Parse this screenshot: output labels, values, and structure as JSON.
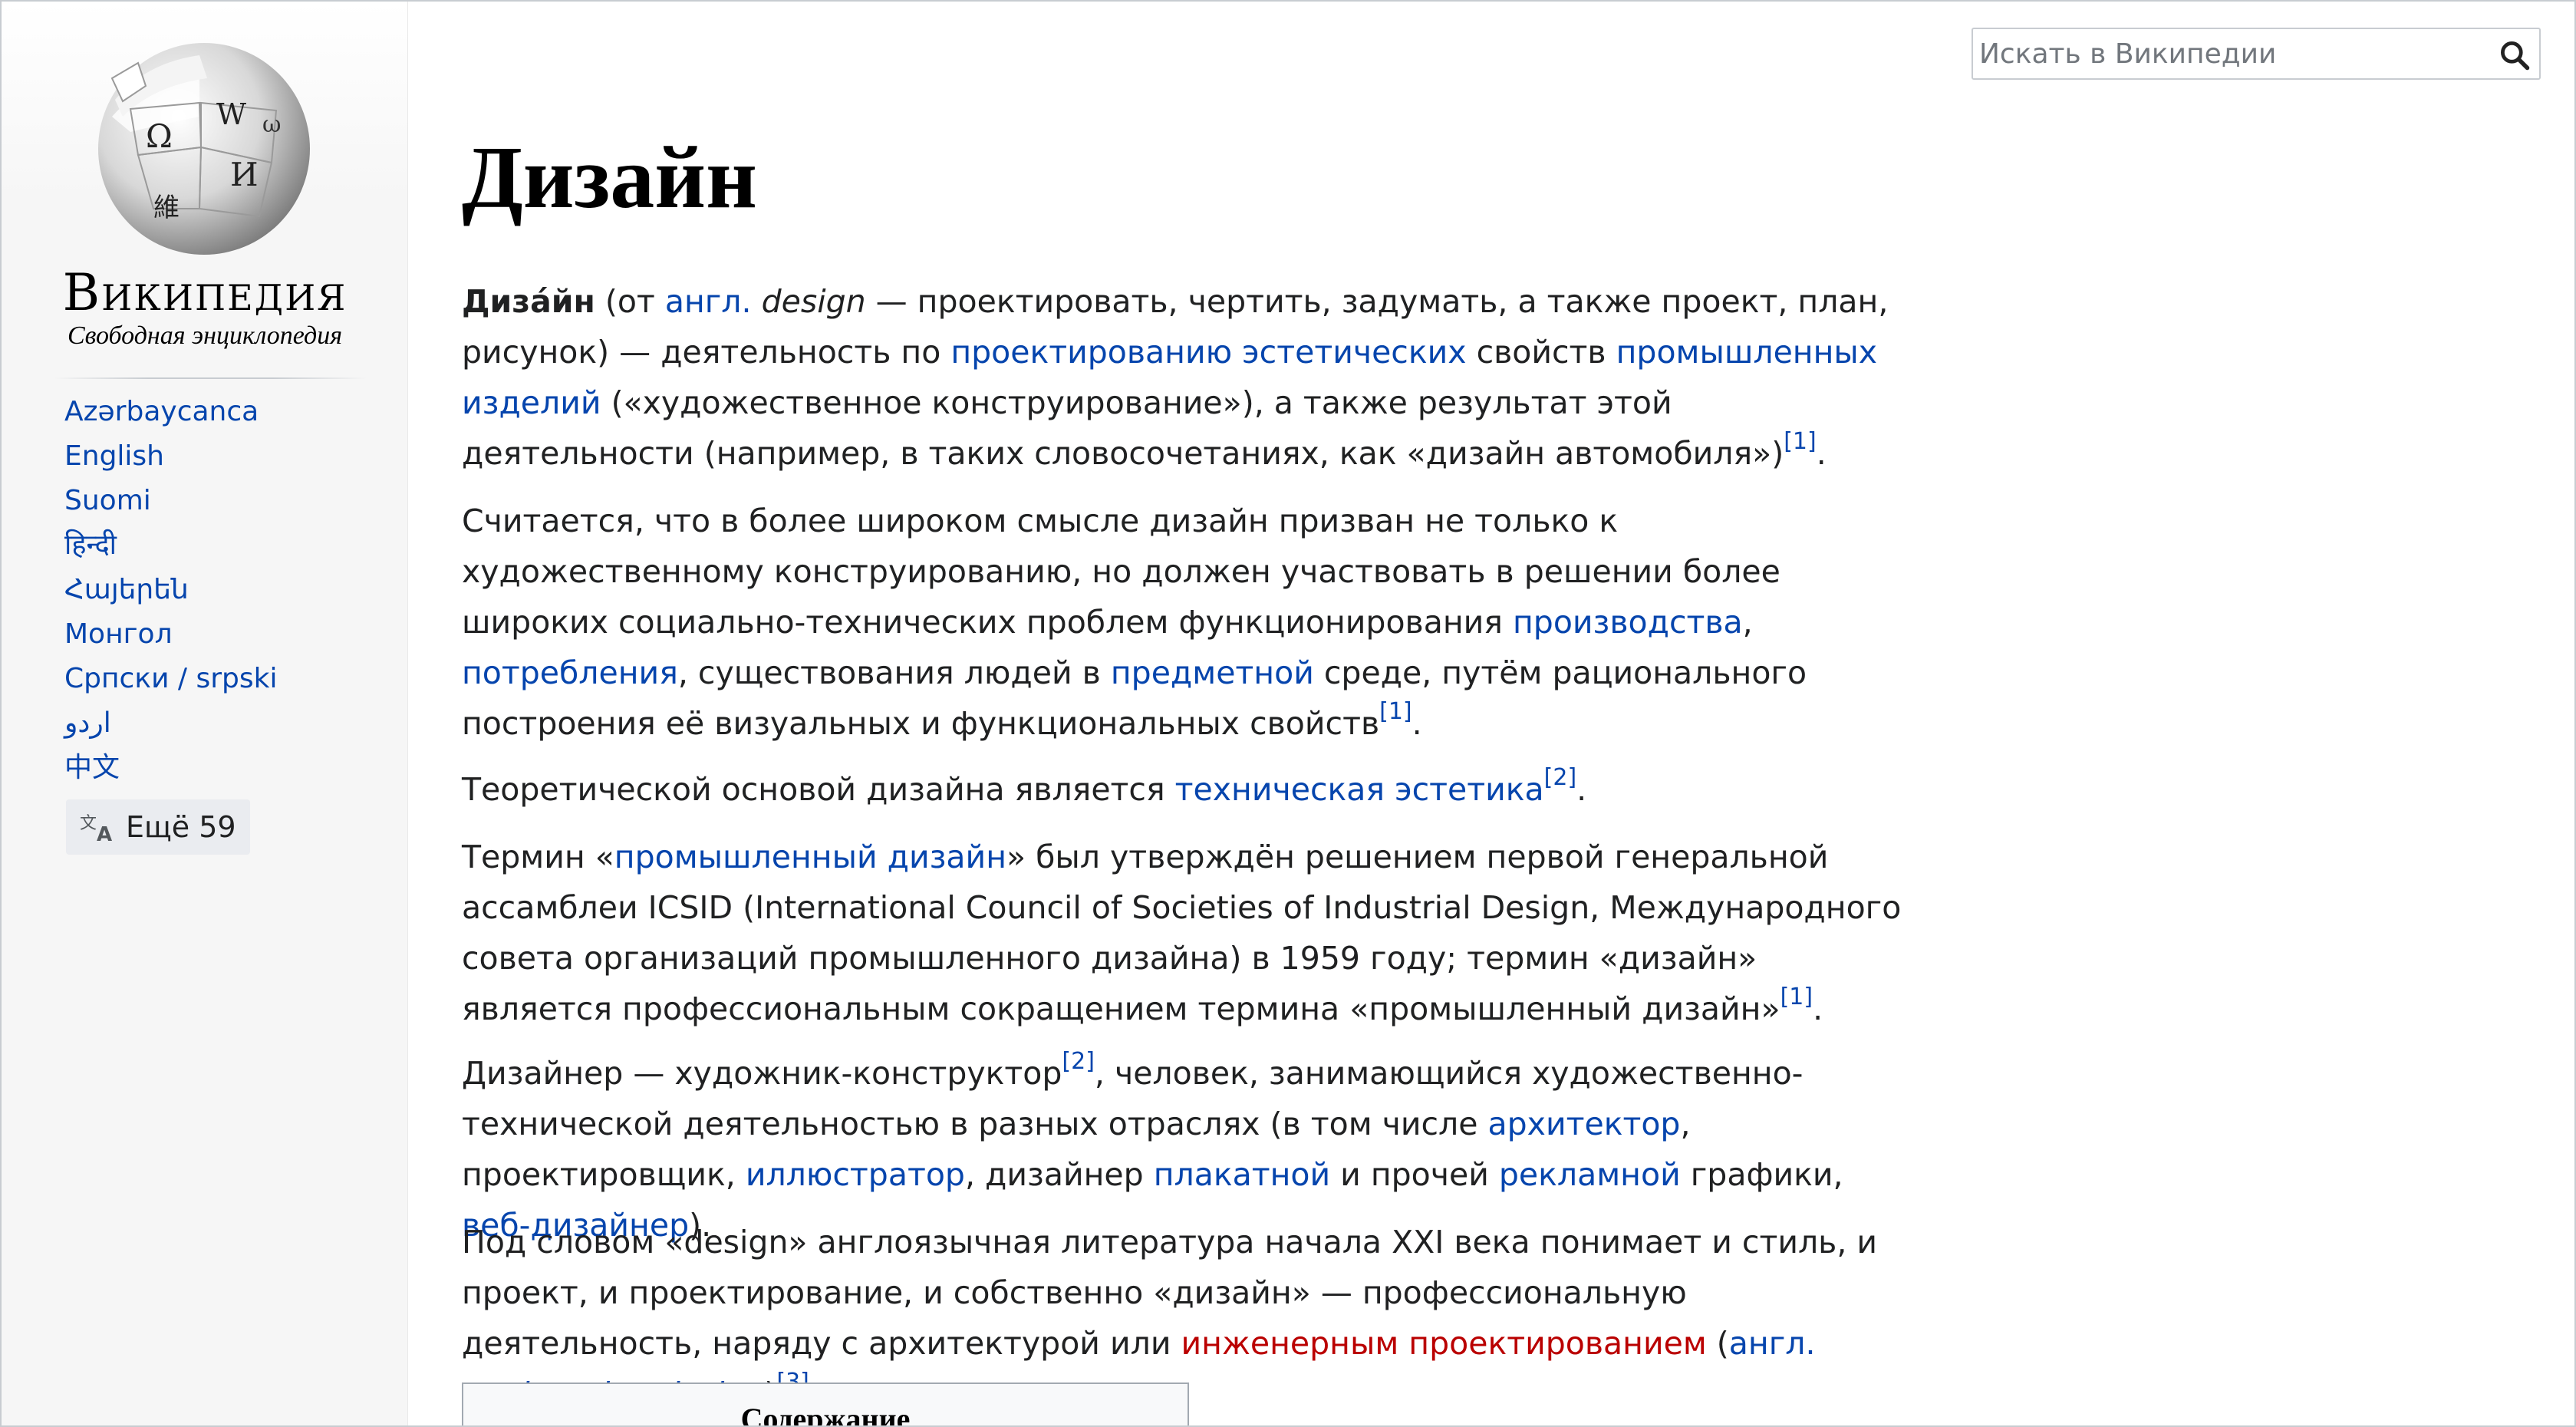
{
  "sidebar": {
    "logo": {
      "wordmark": "Википедия",
      "tagline": "Свободная энциклопедия",
      "globe_glyphs": [
        "Ω",
        "W",
        "И",
        "維",
        "ω"
      ]
    },
    "languages": [
      {
        "label": "Azərbaycanca"
      },
      {
        "label": "English"
      },
      {
        "label": "Suomi"
      },
      {
        "label": "हिन्दी"
      },
      {
        "label": "Հայերեն"
      },
      {
        "label": "Монгол"
      },
      {
        "label": "Српски / srpski"
      },
      {
        "label": "اردو"
      },
      {
        "label": "中文"
      }
    ],
    "more_languages": {
      "label": "Ещё 59",
      "icon": "translate-icon"
    }
  },
  "search": {
    "placeholder": "Искать в Википедии",
    "icon": "search-icon"
  },
  "article": {
    "title": "Дизайн",
    "p1": {
      "bold": "Диза́йн",
      "t1": " (от ",
      "link1": "англ.",
      "t2": " ",
      "italic": "design",
      "t3": " — проектировать, чертить, задумать, а также проект, план, рисунок) — деятельность по ",
      "link2": "проектированию эстетических",
      "t4": " свойств ",
      "link3": "промышленных изделий",
      "t5": " («художественное конструирование»), а также результат этой деятельности (например, в таких словосочетаниях, как «дизайн автомобиля»)",
      "ref": "[1]",
      "t6": "."
    },
    "p2": {
      "t1": "Считается, что в более широком смысле дизайн призван не только к художественному конструированию, но должен участвовать в решении более широких социально-технических проблем функционирования ",
      "link1": "производства",
      "t2": ", ",
      "link2": "потребления",
      "t3": ", существования людей в ",
      "link3": "предметной",
      "t4": " среде, путём рационального построения её визуальных и функциональных свойств",
      "ref": "[1]",
      "t5": "."
    },
    "p3": {
      "t1": "Теоретической основой дизайна является ",
      "link1": "техническая эстетика",
      "ref": "[2]",
      "t2": "."
    },
    "p4": {
      "t1": "Термин «",
      "link1": "промышленный дизайн",
      "t2": "» был утверждён решением первой генеральной ассамблеи ICSID (International Council of Societies of Industrial Design, Международного совета организаций промышленного дизайна) в 1959 году; термин «дизайн» является профессиональным сокращением термина «промышленный дизайн»",
      "ref": "[1]",
      "t3": "."
    },
    "p5": {
      "t1": "Дизайнер — художник-конструктор",
      "ref": "[2]",
      "t2": ", человек, занимающийся художественно-технической деятельностью в разных отраслях (в том числе ",
      "link1": "архитектор",
      "t3": ", проектировщик, ",
      "link2": "иллюстратор",
      "t4": ", дизайнер ",
      "link3": "плакатной",
      "t5": " и прочей ",
      "link4": "рекламной",
      "t6": " графики, ",
      "link5": "веб-дизайнер",
      "t7": ")."
    },
    "p6": {
      "t1": "Под словом «design» англоязычная литература начала XXI века понимает и стиль, и проект, и проектирование, и собственно «дизайн» — профессиональную деятельность, наряду с архитектурой или ",
      "redlink": "инженерным проектированием",
      "t2": " (",
      "link1": "англ.",
      "t3": " ",
      "italic_link": "engineering design",
      "t4": ")",
      "ref": "[3]",
      "t5": "."
    },
    "toc_title": "Содержание"
  },
  "colors": {
    "link": "#0645ad",
    "redlink": "#ba0000",
    "text": "#202122",
    "sidebar_bg": "#f6f6f6"
  }
}
